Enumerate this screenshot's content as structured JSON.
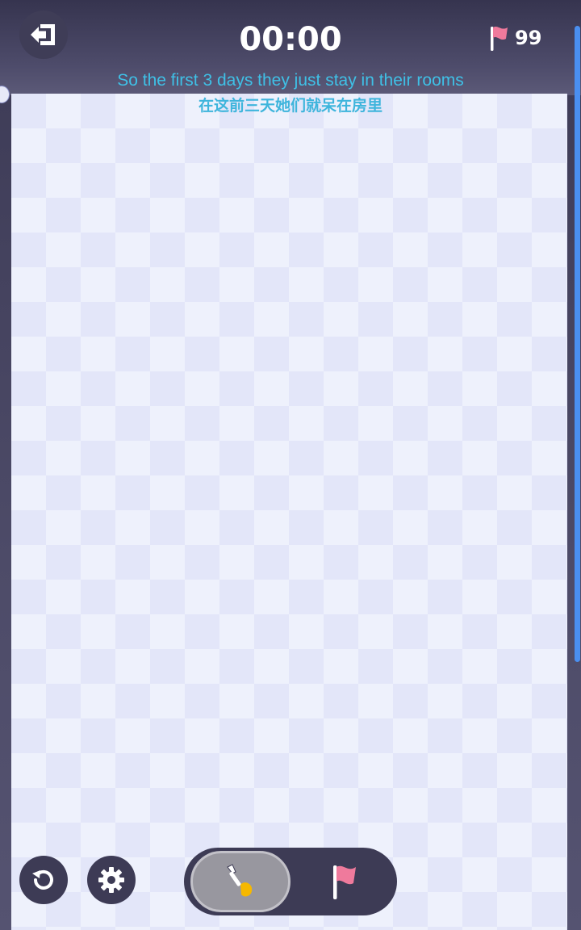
{
  "header": {
    "timer": "00:00",
    "flags_remaining": "99",
    "exit_icon": "exit-icon",
    "flag_icon": "flag-icon"
  },
  "subtitles": {
    "english": "So the first 3 days they just stay in their rooms",
    "chinese": "在这前三天她们就呆在房里"
  },
  "board": {
    "state": "unrevealed",
    "light_tile_color": "#eef1fc",
    "dark_tile_color": "#e3e6f9"
  },
  "controls": {
    "restart_icon": "restart-icon",
    "settings_icon": "gear-icon",
    "mode": {
      "selected": "dig",
      "options": [
        "dig",
        "flag"
      ],
      "dig_icon": "shovel-icon",
      "flag_icon": "flag-icon"
    }
  },
  "colors": {
    "subtitle": "#3fc0e6",
    "flag_pink": "#ef7a9c",
    "shovel_yellow": "#f6b800",
    "scrollbar": "#4a8ff0"
  }
}
